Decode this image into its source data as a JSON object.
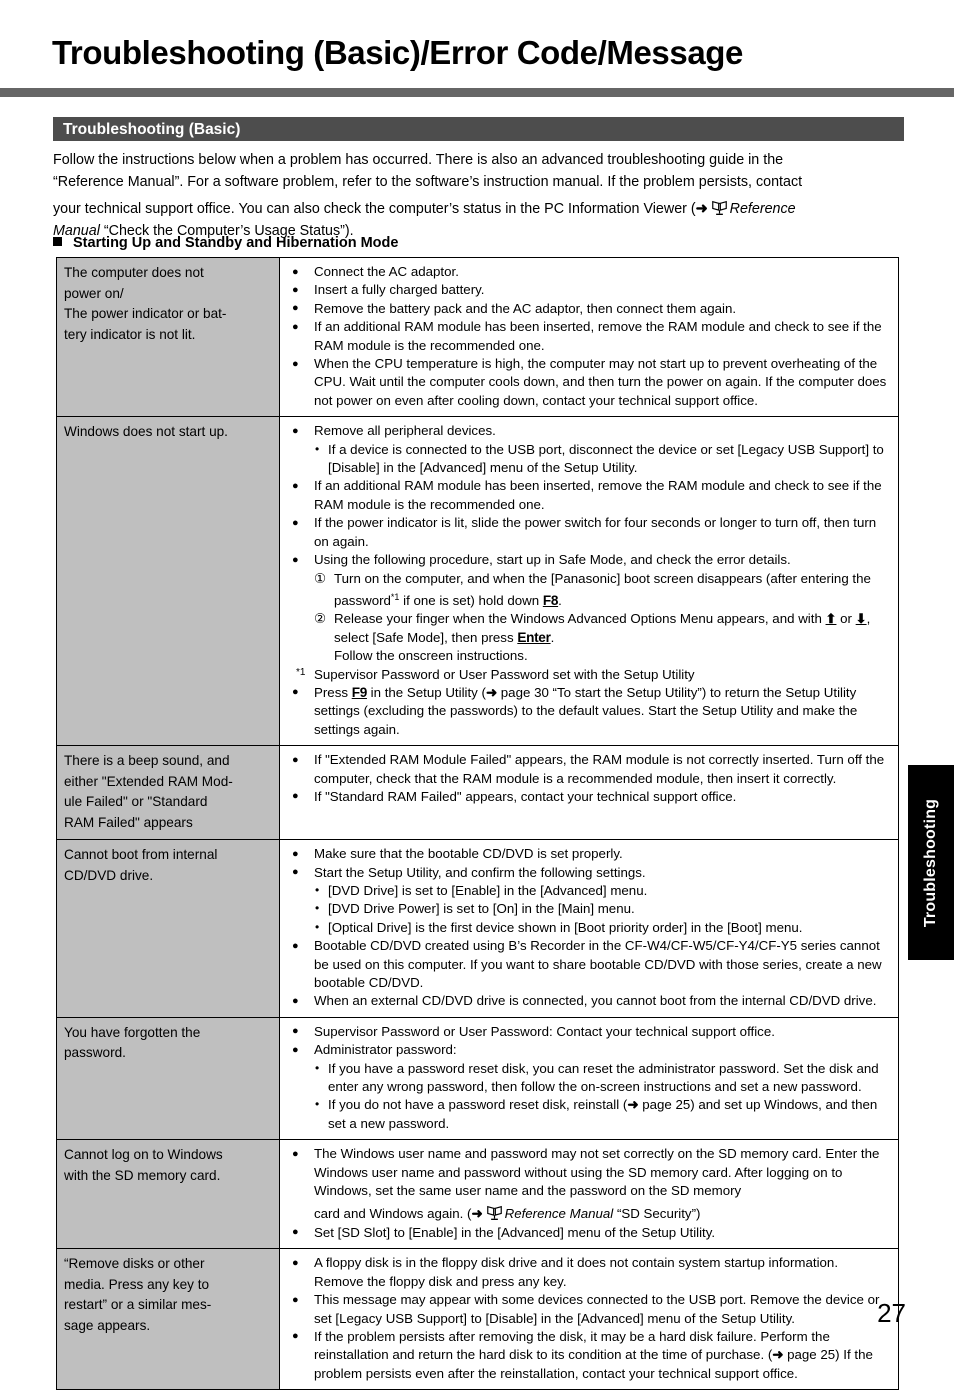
{
  "page": {
    "title": "Troubleshooting (Basic)/Error Code/Message",
    "number": "27",
    "thumb_tab": "Troubleshooting",
    "accent_bar_color": "#666666",
    "section_bar_color": "#4d4d4d",
    "symptom_cell_color": "#bfbfbf"
  },
  "section": {
    "heading": "Troubleshooting (Basic)",
    "intro_line_1": "Follow the instructions below when a problem has occurred. There is also an advanced troubleshooting guide in the",
    "intro_line_2": "“Reference Manual”. For a software problem, refer to the software’s instruction manual. If the problem persists, contact",
    "intro_line_3_a": "your technical support office. You can also check the computer’s status in the PC Information Viewer (",
    "intro_arrow": "➜",
    "intro_ref_icon": "reference-manual-icon",
    "intro_line_3_italic": "Reference",
    "intro_line_4_italic": "Manual",
    "intro_line_4_b": " “Check the Computer’s Usage Status”).",
    "subheading": "Starting Up and Standby and Hibernation Mode"
  },
  "table": {
    "rows": [
      {
        "symptom": "The computer does not power on/\nThe power indicator or battery indicator is not lit.",
        "symptom_lines": [
          "The computer does not",
          "power on/",
          "The power indicator or bat-",
          "tery indicator is not lit."
        ],
        "solutions": [
          "Connect the AC adaptor.",
          "Insert a fully charged battery.",
          "Remove the battery pack and the AC adaptor, then connect them again.",
          "If an additional RAM module has been inserted, remove the RAM module and check to see if the RAM module is the recommended one.",
          "When the CPU temperature is high, the computer may not start up to prevent overheating of the CPU. Wait until the computer cools down, and then turn the power on again. If the computer does not power on even after cooling down, contact your technical support office."
        ]
      },
      {
        "symptom": "Windows does not start up.",
        "symptom_lines": [
          "Windows does not start up."
        ],
        "solutions": [
          "Remove all peripheral devices.",
          "If an additional RAM module has been inserted, remove the RAM module and check to see if the RAM module is the recommended one.",
          "If the power indicator is lit, slide the power switch for four seconds or longer to turn off, then turn on again.",
          "Using the following procedure, start up in Safe Mode, and check the error details."
        ],
        "sub_bullet_1": "If a device is connected to the USB port, disconnect the device or set [Legacy USB Support] to [Disable] in the [Advanced] menu of the Setup Utility.",
        "numbered": [
          {
            "num": "①",
            "text_a": "Turn on the computer, and when the [Panasonic] boot screen disappears (after entering the password",
            "fn": "*1",
            "text_b": " if one is set) hold down ",
            "key": "F8",
            "text_c": "."
          },
          {
            "num": "②",
            "text_a": "Release your finger when the Windows Advanced Options Menu appears, and with ",
            "key_up": "⬆",
            "text_mid": " or ",
            "key_down": "⬇",
            "text_b": ", select [Safe Mode], then press ",
            "key": "Enter",
            "text_c": ".",
            "text_d": "Follow the onscreen instructions."
          }
        ],
        "footnote_mark": "*1",
        "footnote_text": "Supervisor Password or User Password set with the Setup Utility",
        "last_bullet": {
          "text_a": "Press ",
          "key": "F9",
          "text_b": " in the Setup Utility (",
          "arrow": "➜",
          "text_c": " page 30 “To start the Setup Utility”) to return the Setup Utility settings (excluding the passwords) to the default values. Start the Setup Utility and make the settings again."
        }
      },
      {
        "symptom": "There is a beep sound, and either \"Extended RAM Module Failed\" or \"Standard RAM Failed\" appears",
        "symptom_lines": [
          "There is a beep sound, and",
          "either \"Extended RAM Mod-",
          "ule Failed\" or \"Standard",
          "RAM Failed\" appears"
        ],
        "solutions": [
          "If \"Extended RAM Module Failed\" appears, the RAM module is not correctly inserted. Turn off the computer, check that the RAM module is a recommended module, then insert it correctly.",
          "If \"Standard RAM Failed\" appears, contact your technical support office."
        ]
      },
      {
        "symptom": "Cannot boot from internal CD/DVD drive.",
        "symptom_lines": [
          "Cannot boot from internal",
          "CD/DVD drive."
        ],
        "solutions": [
          "Make sure that the bootable CD/DVD is set properly.",
          "Start the Setup Utility, and confirm the following settings.",
          "Bootable CD/DVD created using B’s Recorder in the CF-W4/CF-W5/CF-Y4/CF-Y5 series cannot be used on this computer. If you want to share bootable CD/DVD with those series, create a new bootable CD/DVD.",
          "When an external CD/DVD drive is connected, you cannot boot from the internal CD/DVD drive."
        ],
        "sub_bullets": [
          "[DVD Drive] is set to [Enable] in the [Advanced] menu.",
          "[DVD Drive Power] is set to [On] in the [Main] menu.",
          "[Optical Drive] is the first device shown in [Boot priority order] in the [Boot] menu."
        ]
      },
      {
        "symptom": "You have forgotten the password.",
        "symptom_lines": [
          "You have forgotten the",
          "password."
        ],
        "solutions": [
          "Supervisor Password or User Password: Contact your technical support office.",
          "Administrator password:"
        ],
        "sub_bullets": [
          "If you have a password reset disk, you can reset the administrator password. Set the disk and enter any wrong password, then follow the on-screen instructions and set a new password."
        ],
        "sub_bullet_last": {
          "text_a": "If you do not have a password reset disk, reinstall (",
          "arrow": "➜",
          "text_b": " page 25) and set up Windows, and then set a new password."
        }
      },
      {
        "symptom": "Cannot log on to Windows with the SD memory card.",
        "symptom_lines": [
          "Cannot log on to Windows",
          "with the SD memory card."
        ],
        "solution_1_a": "The Windows user name and password may not set correctly on the SD memory card. Enter the Windows user name and password without using the SD memory card. After logging on to Windows, set the same user name and the password on the SD memory",
        "solution_1_b": "card and Windows again. (",
        "solution_1_arrow": "➜",
        "solution_1_italic": "Reference Manual",
        "solution_1_c": " “SD Security”)",
        "solution_2": "Set [SD Slot] to [Enable] in the [Advanced] menu of the Setup Utility."
      },
      {
        "symptom": "“Remove disks or other media. Press any key to restart” or a similar message appears.",
        "symptom_lines": [
          "“Remove disks or other",
          "media. Press any key to",
          "restart” or a similar mes-",
          "sage appears."
        ],
        "solutions": [
          "A floppy disk is in the floppy disk drive and it does not contain system startup information. Remove the floppy disk and press any key.",
          "This message may appear with some devices connected to the USB port. Remove the device or set [Legacy USB Support] to [Disable] in the [Advanced] menu of the Setup Utility."
        ],
        "solution_last": {
          "text_a": "If the problem persists after removing the disk, it may be a hard disk failure. Perform the reinstallation and return the hard disk to its condition at the time of purchase. (",
          "arrow": "➜",
          "text_b": " page 25) If the problem persists even after the reinstallation, contact your technical support office."
        }
      }
    ]
  }
}
